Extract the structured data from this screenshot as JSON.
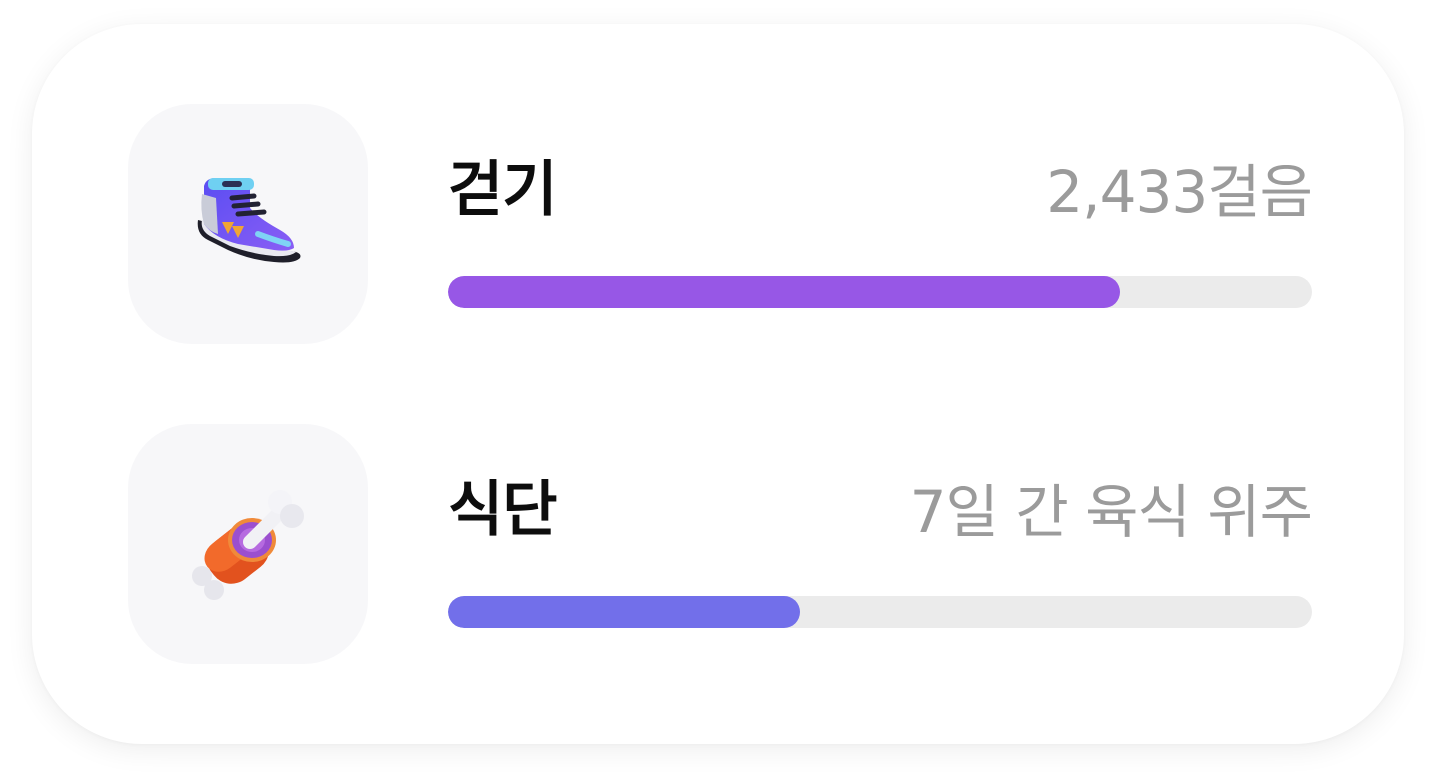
{
  "items": [
    {
      "id": "walk",
      "label": "걷기",
      "value": "2,433걸음",
      "progress": 0.778,
      "color": "#9757e6",
      "icon": "sneaker-icon"
    },
    {
      "id": "diet",
      "label": "식단",
      "value": "7일 간 육식 위주",
      "progress": 0.407,
      "color": "#726fea",
      "icon": "meat-on-bone-icon"
    }
  ]
}
